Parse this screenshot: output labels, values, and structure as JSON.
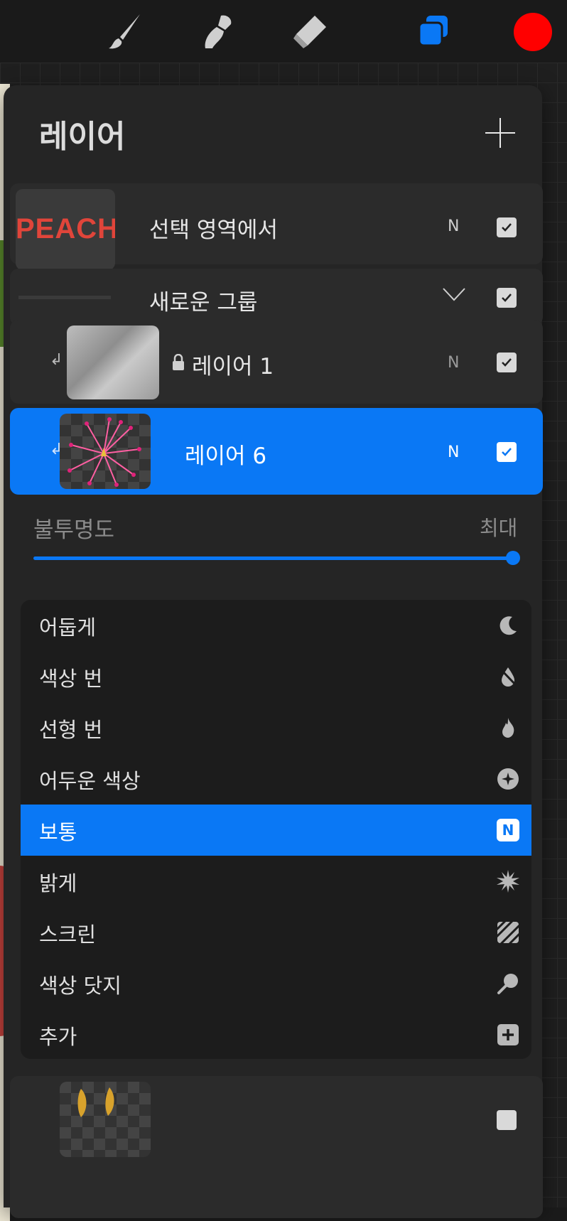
{
  "panel": {
    "title": "레이어"
  },
  "layers": [
    {
      "name": "선택 영역에서",
      "blend": "N",
      "thumb_text": "PEACH"
    },
    {
      "name": "새로운 그룹"
    },
    {
      "name": "레이어 1",
      "blend": "N"
    },
    {
      "name": "레이어 6",
      "blend": "N"
    }
  ],
  "opacity": {
    "label": "불투명도",
    "value_label": "최대",
    "value": 1.0
  },
  "blend_menu": [
    {
      "label": "어둡게",
      "icon": "moon-icon"
    },
    {
      "label": "색상 번",
      "icon": "drop-slash-icon"
    },
    {
      "label": "선형 번",
      "icon": "flame-icon"
    },
    {
      "label": "어두운 색상",
      "icon": "sparkle-circle-icon"
    },
    {
      "label": "보통",
      "icon": "n-badge-icon",
      "badge": "N"
    },
    {
      "label": "밝게",
      "icon": "sun-burst-icon"
    },
    {
      "label": "스크린",
      "icon": "hatch-icon"
    },
    {
      "label": "색상 닷지",
      "icon": "pin-icon"
    },
    {
      "label": "추가",
      "icon": "plus-square-icon"
    }
  ],
  "colors": {
    "accent": "#0a78f5",
    "current_color": "#ff0000"
  }
}
